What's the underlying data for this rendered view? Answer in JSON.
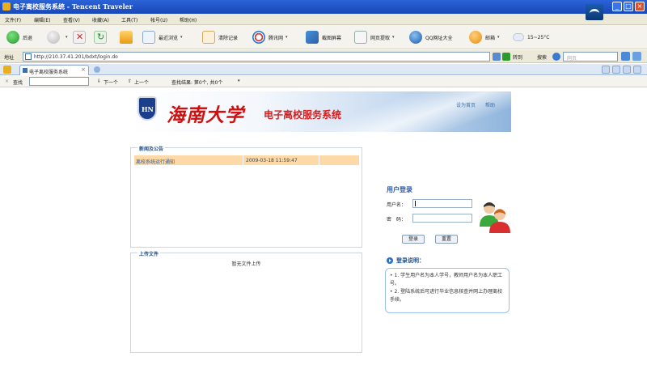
{
  "window": {
    "title": "电子离校服务系统 - Tencent Traveler",
    "controls": [
      "_",
      "□",
      "×"
    ]
  },
  "menu": [
    "文件(F)",
    "编辑(E)",
    "查看(V)",
    "收藏(A)",
    "工具(T)",
    "帐号(U)",
    "帮助(H)"
  ],
  "toolbar": {
    "back": "后退",
    "reading": "最近浏览",
    "clear": "清除记录",
    "speed": "腾讯网",
    "capture": "截图屏幕",
    "webgrab": "网页提取",
    "qq": "QQ网址大全",
    "mail": "邮箱",
    "weather": "15~25°C"
  },
  "address": {
    "label": "地址",
    "url": "http://210.37.41.201/bdxt/login.do",
    "go": "转到",
    "search_label": "搜索",
    "search_placeholder": "网页"
  },
  "tabs": [
    {
      "label": "电子离校服务系统",
      "close": "×"
    }
  ],
  "findbar": {
    "label": "查找",
    "next": "下一个",
    "prev": "上一个",
    "result": "查找结果: 第0个, 共0个"
  },
  "banner": {
    "emblem": "HN",
    "university": "海南大学",
    "system": "电子离校服务系统",
    "link_home": "设为首页",
    "link_help": "帮助"
  },
  "news": {
    "title": "新闻及公告",
    "items": [
      {
        "title": "离校系统运行通知",
        "date": "2009-03-18 11:59:47"
      }
    ]
  },
  "uploads": {
    "title": "上传文件",
    "empty": "暂无文件上传"
  },
  "login": {
    "title": "用户登录",
    "username_label": "用户名：",
    "password_label": "密　码：",
    "submit": "登录",
    "reset": "重置"
  },
  "info": {
    "title": "登录说明：",
    "lines": [
      "• 1. 学生用户名为本人学号，教师用户名为本人职工号。",
      "• 2. 登陆系统后可进行毕业信息核查并网上办理离校手续。"
    ]
  },
  "colors": {
    "title_bar": "#1947b8",
    "news_row": "#fcd9a6",
    "accent": "#2a5aa8",
    "brand_red": "#d01010"
  }
}
